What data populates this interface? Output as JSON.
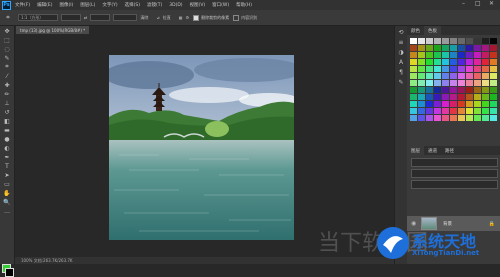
{
  "app": {
    "logo": "Ps",
    "accent": "#31a8ff"
  },
  "menu": [
    "文件(F)",
    "编辑(E)",
    "图像(I)",
    "图层(L)",
    "文字(Y)",
    "选择(S)",
    "滤镜(T)",
    "3D(D)",
    "视图(V)",
    "窗口(W)",
    "帮助(H)"
  ],
  "window_controls": [
    "–",
    "□",
    "✕"
  ],
  "options": {
    "mode_value": "1:1（方形）",
    "resolution_label": "清除",
    "straighten_label": "拉直",
    "delete_label": "删除裁剪的像素",
    "content_aware_label": "内容识别"
  },
  "document_tab": "tmp (13).jpg @ 100%(RGB/8#) *",
  "status_text": "100%    文档:263.7K/263.7K",
  "panels": {
    "swatch_tabs": [
      "颜色",
      "色板"
    ],
    "layer_tabs": [
      "图层",
      "通道",
      "路径"
    ],
    "layer_name": "背景"
  },
  "colors": {
    "foreground": "#35d035",
    "background": "#000000"
  },
  "watermark": {
    "brand": "系统天地",
    "url": "XiTongTianDi.net",
    "faint": "当下软件园"
  }
}
